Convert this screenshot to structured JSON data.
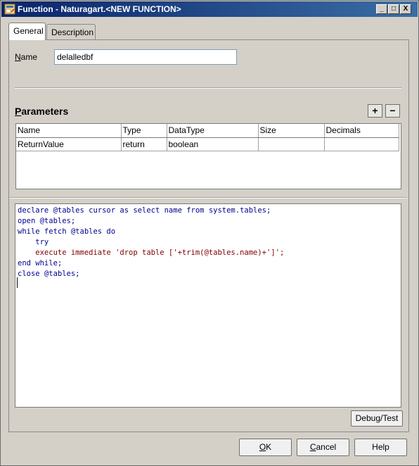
{
  "window": {
    "title": "Function - Naturagart.<NEW FUNCTION>",
    "minimize": "_",
    "maximize": "□",
    "close": "X"
  },
  "tabs": [
    {
      "label": "General",
      "active": true
    },
    {
      "label": "Description",
      "active": false
    }
  ],
  "general": {
    "name_label_first": "N",
    "name_label_rest": "ame",
    "name_value": "delalledbf",
    "parameters_title_first": "P",
    "parameters_title_rest": "arameters",
    "add_label": "+",
    "remove_label": "−"
  },
  "parameters": {
    "columns": [
      "Name",
      "Type",
      "DataType",
      "Size",
      "Decimals"
    ],
    "rows": [
      [
        "ReturnValue",
        "return",
        "boolean",
        "",
        ""
      ]
    ]
  },
  "code": {
    "lines": [
      "declare @tables cursor as select name from system.tables;",
      "open @tables;",
      "while fetch @tables do",
      "    try",
      "    execute immediate 'drop table ['+trim(@tables.name)+']';",
      "end while;",
      "close @tables;"
    ]
  },
  "buttons": {
    "debug_test": "Debug/Test",
    "ok_first": "O",
    "ok_rest": "K",
    "cancel_first": "C",
    "cancel_rest": "ancel",
    "help": "Help"
  },
  "colors": {
    "titlebar_start": "#0a246a",
    "titlebar_end": "#3a6ea5",
    "code_keyword": "#00008b",
    "code_string": "#800000"
  }
}
